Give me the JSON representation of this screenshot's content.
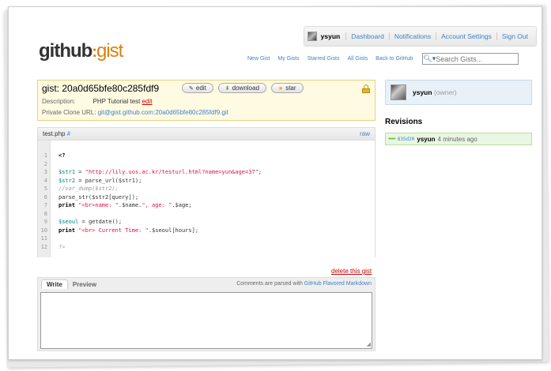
{
  "header": {
    "username": "ysyun",
    "links": [
      "Dashboard",
      "Notifications",
      "Account Settings",
      "Sign Out"
    ],
    "logo_main": "github",
    "logo_sep": ":",
    "logo_sub": "gist",
    "subnav": [
      "New Gist",
      "My Gists",
      "Starred Gists",
      "All Gists",
      "Back to GitHub"
    ],
    "search_placeholder": "Search Gists..."
  },
  "gist": {
    "title": "gist: 20a0d65bfe80c285fdf9",
    "buttons": [
      "edit",
      "download",
      "star"
    ],
    "description_label": "Description:",
    "description": "PHP Tutorial test",
    "description_edit": "edit",
    "clone_label": "Private Clone URL:",
    "clone_url": "git@gist.github.com:20a0d65bfe80c285fdf9.git"
  },
  "file": {
    "name": "test.php",
    "anchor": "#",
    "raw_label": "raw",
    "line_numbers": [
      "1",
      "2",
      "3",
      "4",
      "5",
      "6",
      "7",
      "8",
      "9",
      "10",
      "11",
      "12"
    ],
    "code": {
      "l1": "<?",
      "l3_var": "$str1",
      "l3_eq": " = ",
      "l3_str": "\"http://lily.uos.ac.kr/testurl.html?name=yun&age=37\"",
      "l3_end": ";",
      "l4_var": "$str2",
      "l4_rest": " = parse_url($str1);",
      "l5": "//var_dump($str2);",
      "l6": "parse_str($str2[query]);",
      "l7_kw": "print",
      "l7_str1": "\"<br>name: \"",
      "l7_mid": ".$name.",
      "l7_str2": "\", age: \"",
      "l7_end": ".$age;",
      "l9_var": "$seoul",
      "l9_rest": " = getdate();",
      "l10_kw": "print",
      "l10_str": "\"<br> Current Time: \"",
      "l10_end": ".$seoul[hours];",
      "l12": "?>"
    }
  },
  "delete_label": "delete this gist",
  "comment": {
    "tabs": [
      "Write",
      "Preview"
    ],
    "note_prefix": "Comments are parsed with",
    "note_link": "GitHub Flavored Markdown"
  },
  "sidebar": {
    "owner_name": "ysyun",
    "owner_role": "(owner)",
    "revisions_title": "Revisions",
    "revision": {
      "dots": "••••••",
      "hash": "835d20",
      "user": "ysyun",
      "time": "4 minutes ago"
    }
  },
  "colors": {
    "link": "#4183c4",
    "brand_orange": "#d9820f",
    "info_bg": "#fffbe2",
    "owner_bg": "#e8f1f8",
    "revision_bg": "#e9f7e2",
    "delete_red": "#cc0000"
  }
}
